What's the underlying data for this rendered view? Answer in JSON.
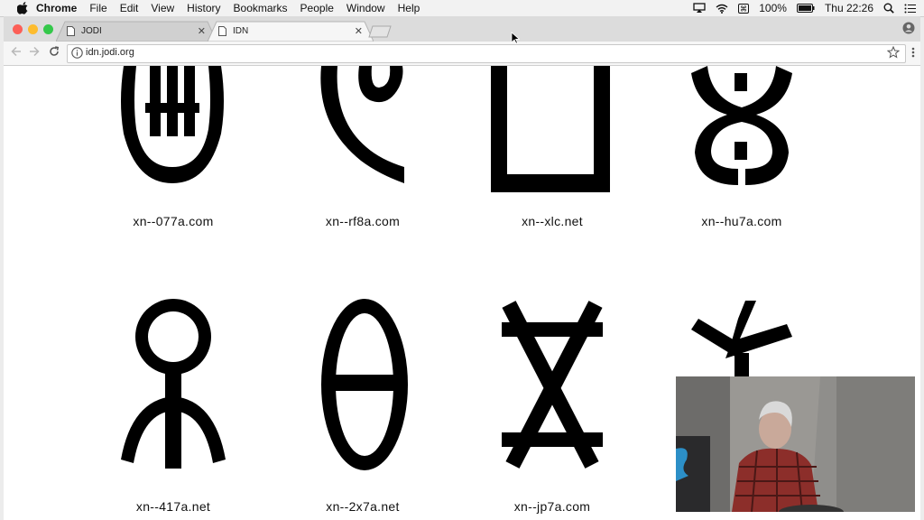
{
  "menubar": {
    "app_name": "Chrome",
    "items": [
      "File",
      "Edit",
      "View",
      "History",
      "Bookmarks",
      "People",
      "Window",
      "Help"
    ],
    "battery": "100%",
    "clock": "Thu 22:26",
    "icons": [
      "apple-icon",
      "airplay-icon",
      "wifi-icon",
      "keyboard-icon",
      "battery-icon",
      "spotlight-icon",
      "notification-icon"
    ]
  },
  "browser": {
    "tabs": [
      {
        "title": "JODI",
        "active": false
      },
      {
        "title": "IDN",
        "active": true
      }
    ],
    "url": "idn.jodi.org"
  },
  "page": {
    "domains": [
      {
        "caption": "xn--077a.com",
        "glyph": "circle-bars"
      },
      {
        "caption": "xn--rf8a.com",
        "glyph": "hook-spiral"
      },
      {
        "caption": "xn--xlc.net",
        "glyph": "square-bracket"
      },
      {
        "caption": "xn--hu7a.com",
        "glyph": "double-loop"
      },
      {
        "caption": "xn--417a.net",
        "glyph": "ring-figure"
      },
      {
        "caption": "xn--2x7a.net",
        "glyph": "theta"
      },
      {
        "caption": "xn--jp7a.com",
        "glyph": "crossed-x"
      },
      {
        "caption": "",
        "glyph": "zigzag"
      }
    ]
  },
  "colors": {
    "close": "#fc5f57",
    "minimize": "#fdbc2e",
    "maximize": "#34c84a",
    "glyph": "#000000"
  }
}
